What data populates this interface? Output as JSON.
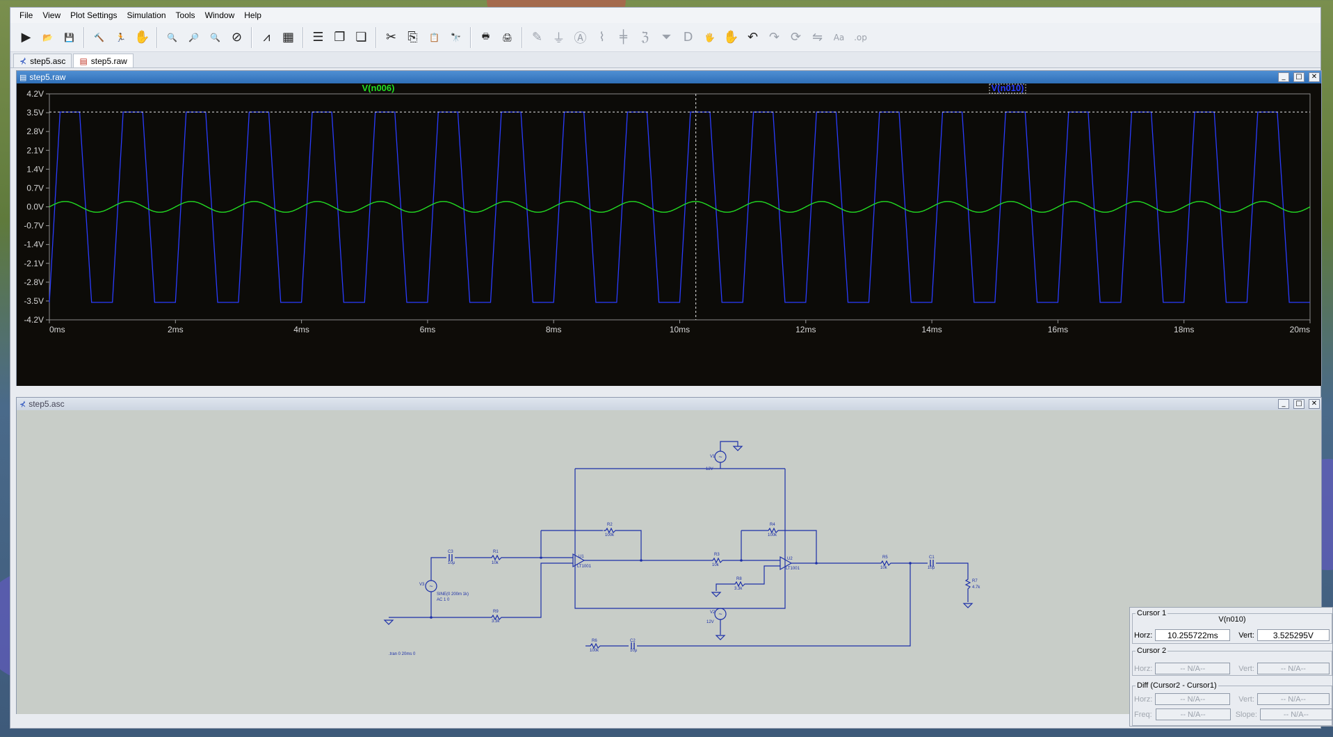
{
  "menubar": [
    "File",
    "View",
    "Plot Settings",
    "Simulation",
    "Tools",
    "Window",
    "Help"
  ],
  "toolbar": [
    {
      "icon": "run-icon",
      "glyph": "▶"
    },
    {
      "icon": "open-icon",
      "glyph": "📂"
    },
    {
      "icon": "save-icon",
      "glyph": "💾"
    },
    {
      "sep": true
    },
    {
      "icon": "control-panel-icon",
      "glyph": "🔨"
    },
    {
      "icon": "halt-icon",
      "glyph": "🏃"
    },
    {
      "icon": "pan-hand-icon",
      "glyph": "✋"
    },
    {
      "sep": true
    },
    {
      "icon": "zoom-area-icon",
      "glyph": "🔍"
    },
    {
      "icon": "zoom-in-icon",
      "glyph": "🔎"
    },
    {
      "icon": "zoom-out-icon",
      "glyph": "🔍"
    },
    {
      "icon": "zoom-fit-icon",
      "glyph": "⊘"
    },
    {
      "sep": true
    },
    {
      "icon": "autorange-icon",
      "glyph": "⩘"
    },
    {
      "icon": "manual-limits-icon",
      "glyph": "▦"
    },
    {
      "sep": true
    },
    {
      "icon": "tile-horizontal-icon",
      "glyph": "☰"
    },
    {
      "icon": "cascade-icon",
      "glyph": "❐"
    },
    {
      "icon": "tile-vertical-icon",
      "glyph": "❏"
    },
    {
      "sep": true
    },
    {
      "icon": "cut-icon",
      "glyph": "✂"
    },
    {
      "icon": "copy-icon",
      "glyph": "⎘"
    },
    {
      "icon": "paste-icon",
      "glyph": "📋"
    },
    {
      "icon": "find-icon",
      "glyph": "🔭"
    },
    {
      "sep": true
    },
    {
      "icon": "print-preview-icon",
      "glyph": "🖶"
    },
    {
      "icon": "print-icon",
      "glyph": "🖨"
    },
    {
      "sep": true
    },
    {
      "icon": "draw-wire-icon",
      "glyph": "✎",
      "dim": true
    },
    {
      "icon": "ground-icon",
      "glyph": "⏚",
      "dim": true
    },
    {
      "icon": "label-net-icon",
      "glyph": "Ⓐ",
      "dim": true
    },
    {
      "icon": "resistor-icon",
      "glyph": "⌇",
      "dim": true
    },
    {
      "icon": "capacitor-icon",
      "glyph": "╪",
      "dim": true
    },
    {
      "icon": "inductor-icon",
      "glyph": "ℨ",
      "dim": true
    },
    {
      "icon": "diode-icon",
      "glyph": "⏷",
      "dim": true
    },
    {
      "icon": "component-icon",
      "glyph": "D",
      "dim": true
    },
    {
      "icon": "drag-icon",
      "glyph": "🖐",
      "dim": true
    },
    {
      "icon": "move-icon",
      "glyph": "✋",
      "dim": true
    },
    {
      "icon": "undo-icon",
      "glyph": "↶",
      "dim": false
    },
    {
      "icon": "redo-icon",
      "glyph": "↷",
      "dim": true
    },
    {
      "icon": "rotate-icon",
      "glyph": "⟳",
      "dim": true
    },
    {
      "icon": "mirror-icon",
      "glyph": "⇋",
      "dim": true
    },
    {
      "icon": "text-icon",
      "glyph": "Aa",
      "dim": true
    },
    {
      "icon": "spice-directive-icon",
      "glyph": ".op",
      "dim": true
    }
  ],
  "tabs": [
    {
      "label": "step5.asc",
      "icon": "schematic-tab-icon",
      "active": false
    },
    {
      "label": "step5.raw",
      "icon": "waveform-tab-icon",
      "active": true
    }
  ],
  "plot_window": {
    "title": "step5.raw"
  },
  "schematic_window": {
    "title": "step5.asc"
  },
  "chart_data": {
    "type": "line",
    "legend": [
      "V(n006)",
      "V(n010)"
    ],
    "series": [
      {
        "name": "V(n006)",
        "color": "#22dd22",
        "kind": "sine",
        "amplitude": 0.2,
        "frequency_hz": 1000,
        "offset": 0
      },
      {
        "name": "V(n010)",
        "color": "#2a3cff",
        "kind": "square",
        "high": 3.525,
        "low": -3.55,
        "frequency_hz": 1000,
        "slew_ms": 0.17
      }
    ],
    "xlim": [
      0,
      20
    ],
    "ylim": [
      -4.2,
      4.2
    ],
    "x_ticks": [
      "0ms",
      "2ms",
      "4ms",
      "6ms",
      "8ms",
      "10ms",
      "12ms",
      "14ms",
      "16ms",
      "18ms",
      "20ms"
    ],
    "y_ticks": [
      "4.2V",
      "3.5V",
      "2.8V",
      "2.1V",
      "1.4V",
      "0.7V",
      "0.0V",
      "-0.7V",
      "-1.4V",
      "-2.1V",
      "-2.8V",
      "-3.5V",
      "-4.2V"
    ],
    "cursor": {
      "x_ms": 10.255722,
      "y": 3.525295
    }
  },
  "schematic": {
    "labels": {
      "V1": "V1",
      "V1v": "12V",
      "V2": "V2",
      "V2v": "12V",
      "V3": "V3",
      "V3a": "SINE(0 200m 1k)",
      "V3b": "AC 1 0",
      "C3": "C3",
      "C3v": "10µ",
      "R1": "R1",
      "R1v": "10k",
      "R2": "R2",
      "R2v": "100k",
      "R3": "R3",
      "R3v": "10k",
      "R4": "R4",
      "R4v": "100k",
      "R5": "R5",
      "R5v": "10k",
      "R6": "R6",
      "R6v": "100k",
      "R7": "R7",
      "R7v": "4.7k",
      "R8": "R8",
      "R8v": "3.3k",
      "R9": "R9",
      "R9v": "3.3k",
      "C1": "C1",
      "C1v": "10µ",
      "C2": "C2",
      "C2v": "10µ",
      "U1": "U1",
      "U1v": "LT1001",
      "U2": "U2",
      "U2v": "LT1001",
      "tran": ".tran 0 20ms 0"
    }
  },
  "cursor_panel": {
    "cursor1": {
      "title": "Cursor 1",
      "trace": "V(n010)",
      "horz_label": "Horz:",
      "horz": "10.255722ms",
      "vert_label": "Vert:",
      "vert": "3.525295V"
    },
    "cursor2": {
      "title": "Cursor 2",
      "horz_label": "Horz:",
      "horz": "-- N/A--",
      "vert_label": "Vert:",
      "vert": "-- N/A--"
    },
    "diff": {
      "title": "Diff (Cursor2 - Cursor1)",
      "horz_label": "Horz:",
      "horz": "-- N/A--",
      "vert_label": "Vert:",
      "vert": "-- N/A--",
      "freq_label": "Freq:",
      "freq": "-- N/A--",
      "slope_label": "Slope:",
      "slope": "-- N/A--"
    }
  }
}
